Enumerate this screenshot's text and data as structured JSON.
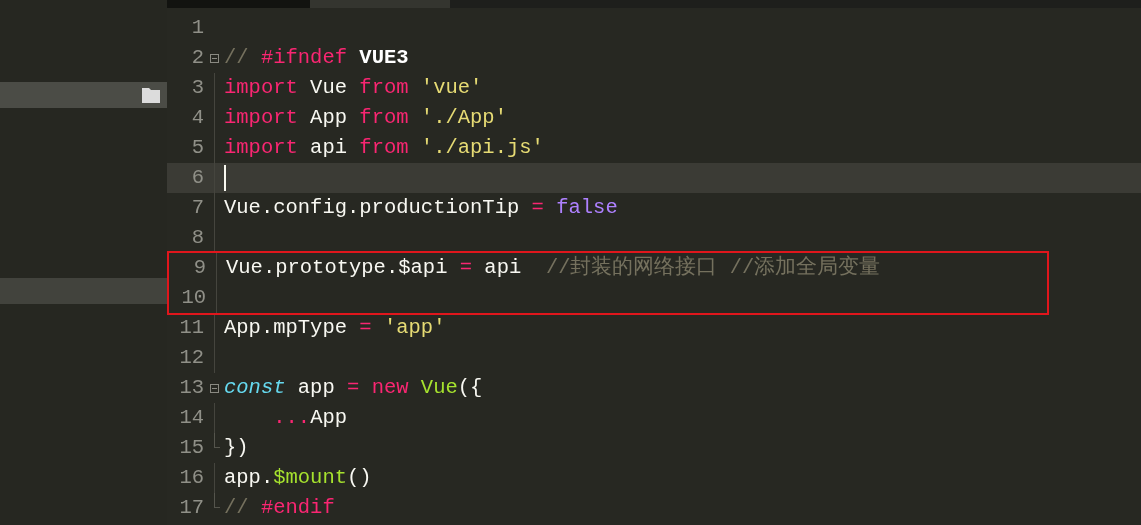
{
  "tabs": [
    {
      "selected": false
    },
    {
      "selected": true
    }
  ],
  "sidebar": {
    "rows": [
      {
        "kind": "folder",
        "selected": true
      },
      {
        "kind": "plain",
        "selected": true
      }
    ]
  },
  "editor": {
    "lines": [
      {
        "number": "1",
        "foldable": false,
        "fold_end": false
      },
      {
        "number": "2",
        "foldable": true,
        "fold_end": false,
        "tokens": [
          {
            "text": "// ",
            "kind": "comment"
          },
          {
            "text": "#ifndef",
            "kind": "keyword"
          },
          {
            "text": " VUE3",
            "kind": "bold"
          }
        ]
      },
      {
        "number": "3",
        "foldable": false,
        "fold_end": false,
        "tokens": [
          {
            "text": "import",
            "kind": "keyword"
          },
          {
            "text": " Vue "
          },
          {
            "text": "from",
            "kind": "keyword"
          },
          {
            "text": " 'vue'",
            "kind": "string"
          }
        ]
      },
      {
        "number": "4",
        "foldable": false,
        "fold_end": false,
        "tokens": [
          {
            "text": "import",
            "kind": "keyword"
          },
          {
            "text": " App "
          },
          {
            "text": "from",
            "kind": "keyword"
          },
          {
            "text": " './App'",
            "kind": "string"
          }
        ]
      },
      {
        "number": "5",
        "foldable": false,
        "fold_end": false,
        "tokens": [
          {
            "text": "import",
            "kind": "keyword"
          },
          {
            "text": " api "
          },
          {
            "text": "from",
            "kind": "keyword"
          },
          {
            "text": " './api.js'",
            "kind": "string"
          }
        ]
      },
      {
        "number": "6",
        "foldable": false,
        "fold_end": false,
        "current": true
      },
      {
        "number": "7",
        "foldable": false,
        "fold_end": false,
        "tokens": [
          {
            "text": "Vue.config.productionTip "
          },
          {
            "text": "=",
            "kind": "keyword"
          },
          {
            "text": " false",
            "kind": "constant"
          }
        ]
      },
      {
        "number": "8",
        "foldable": false,
        "fold_end": false
      },
      {
        "number": "9",
        "foldable": false,
        "fold_end": false,
        "boxed": true,
        "tokens": [
          {
            "text": "Vue.prototype.$api "
          },
          {
            "text": "=",
            "kind": "keyword"
          },
          {
            "text": " api  "
          },
          {
            "text": "//封装的网络接口 //添加全局变量",
            "kind": "comment"
          }
        ]
      },
      {
        "number": "10",
        "foldable": false,
        "fold_end": false,
        "boxed": true
      },
      {
        "number": "11",
        "foldable": false,
        "fold_end": false,
        "tokens": [
          {
            "text": "App.mpType "
          },
          {
            "text": "=",
            "kind": "keyword"
          },
          {
            "text": " 'app'",
            "kind": "string"
          }
        ]
      },
      {
        "number": "12",
        "foldable": false,
        "fold_end": false
      },
      {
        "number": "13",
        "foldable": true,
        "fold_end": false,
        "tokens": [
          {
            "text": "const",
            "kind": "storage"
          },
          {
            "text": " app "
          },
          {
            "text": "=",
            "kind": "keyword"
          },
          {
            "text": " new",
            "kind": "keyword"
          },
          {
            "text": " Vue",
            "kind": "function"
          },
          {
            "text": "({"
          }
        ]
      },
      {
        "number": "14",
        "foldable": false,
        "fold_end": false,
        "tokens": [
          {
            "text": "    ...",
            "kind": "keyword"
          },
          {
            "text": "App"
          }
        ]
      },
      {
        "number": "15",
        "foldable": false,
        "fold_end": true,
        "tokens": [
          {
            "text": "})"
          }
        ]
      },
      {
        "number": "16",
        "foldable": false,
        "fold_end": false,
        "tokens": [
          {
            "text": "app."
          },
          {
            "text": "$mount",
            "kind": "function"
          },
          {
            "text": "()"
          }
        ]
      },
      {
        "number": "17",
        "foldable": false,
        "fold_end": true,
        "tokens": [
          {
            "text": "// ",
            "kind": "comment"
          },
          {
            "text": "#endif",
            "kind": "keyword"
          }
        ]
      }
    ]
  }
}
